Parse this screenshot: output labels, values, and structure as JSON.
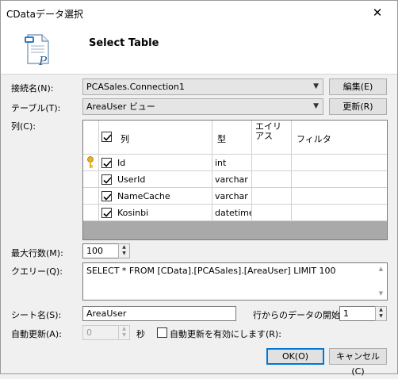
{
  "window": {
    "title": "CDataデータ選択",
    "close_symbol": "✕"
  },
  "header": {
    "title": "Select Table",
    "logo_icon": "document-p-icon"
  },
  "connection": {
    "label": "接続名(N):",
    "value": "PCASales.Connection1",
    "edit_button": "編集(E)"
  },
  "table": {
    "label": "テーブル(T):",
    "value": "AreaUser ビュー",
    "refresh_button": "更新(R)"
  },
  "columns": {
    "label": "列(C):",
    "headers": {
      "col": "列",
      "type": "型",
      "alias": "エイリアス",
      "filter": "フィルタ"
    },
    "rows": [
      {
        "key": true,
        "checked": true,
        "name": "Id",
        "type": "int",
        "alias": "",
        "filter": ""
      },
      {
        "key": false,
        "checked": true,
        "name": "UserId",
        "type": "varchar",
        "alias": "",
        "filter": ""
      },
      {
        "key": false,
        "checked": true,
        "name": "NameCache",
        "type": "varchar",
        "alias": "",
        "filter": ""
      },
      {
        "key": false,
        "checked": true,
        "name": "Kosinbi",
        "type": "datetime",
        "alias": "",
        "filter": ""
      }
    ]
  },
  "max_rows": {
    "label": "最大行数(M):",
    "value": "100"
  },
  "query": {
    "label": "クエリー(Q):",
    "value": "SELECT * FROM [CData].[PCASales].[AreaUser] LIMIT 100"
  },
  "sheet": {
    "label": "シート名(S):",
    "value": "AreaUser",
    "start_row_label": "行からのデータの開始",
    "start_row_value": "1"
  },
  "auto_refresh": {
    "label": "自動更新(A):",
    "value": "0",
    "unit": "秒",
    "checkbox_label": "自動更新を有効にします(R):"
  },
  "footer": {
    "ok_button": "OK(O)",
    "cancel_button": "キャンセル(C)"
  }
}
